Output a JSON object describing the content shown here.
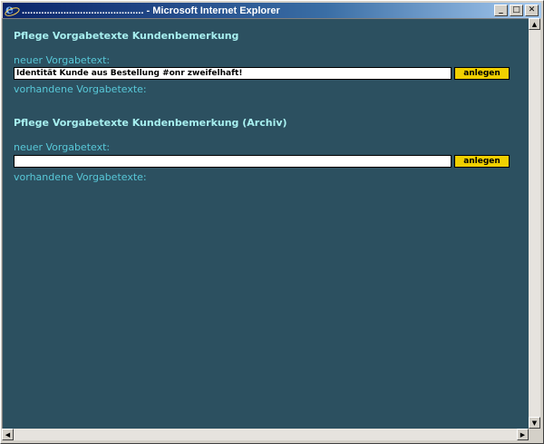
{
  "window": {
    "title": "............................................ - Microsoft Internet Explorer",
    "minimize": "_",
    "maximize": "□",
    "close": "✕"
  },
  "sections": [
    {
      "title": "Pflege Vorgabetexte Kundenbemerkung",
      "new_label": "neuer Vorgabetext:",
      "input_value": "Identität Kunde aus Bestellung #onr zweifelhaft!",
      "button_label": "anlegen",
      "existing_label": "vorhandene Vorgabetexte:"
    },
    {
      "title": "Pflege Vorgabetexte Kundenbemerkung (Archiv)",
      "new_label": "neuer Vorgabetext:",
      "input_value": "",
      "button_label": "anlegen",
      "existing_label": "vorhandene Vorgabetexte:"
    }
  ],
  "icons": {
    "browser": "ie-logo-icon",
    "scroll_up": "▲",
    "scroll_down": "▼",
    "scroll_left": "◀",
    "scroll_right": "▶"
  },
  "colors": {
    "background": "#2c5060",
    "heading": "#a8f0f0",
    "label": "#58c8d8",
    "button": "#f0d000"
  }
}
